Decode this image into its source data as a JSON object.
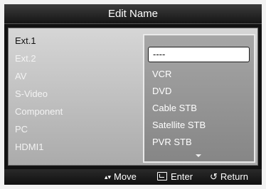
{
  "title": "Edit Name",
  "sources": [
    {
      "name": "Ext.1",
      "colon": ":",
      "active": true
    },
    {
      "name": "Ext.2",
      "colon": ":",
      "active": false
    },
    {
      "name": "AV",
      "colon": ":",
      "active": false
    },
    {
      "name": "S-Video",
      "colon": ":",
      "active": false
    },
    {
      "name": "Component",
      "colon": ":",
      "active": false
    },
    {
      "name": "PC",
      "colon": ":",
      "active": false
    },
    {
      "name": "HDMI1",
      "colon": ":",
      "active": false
    }
  ],
  "dropdown": {
    "selected": "----",
    "options": [
      "VCR",
      "DVD",
      "Cable STB",
      "Satellite STB",
      "PVR STB"
    ],
    "more_indicator": "down-arrow"
  },
  "footer": {
    "move_icon": "▴▾",
    "move": "Move",
    "enter": "Enter",
    "return_icon": "↺",
    "return": "Return"
  }
}
